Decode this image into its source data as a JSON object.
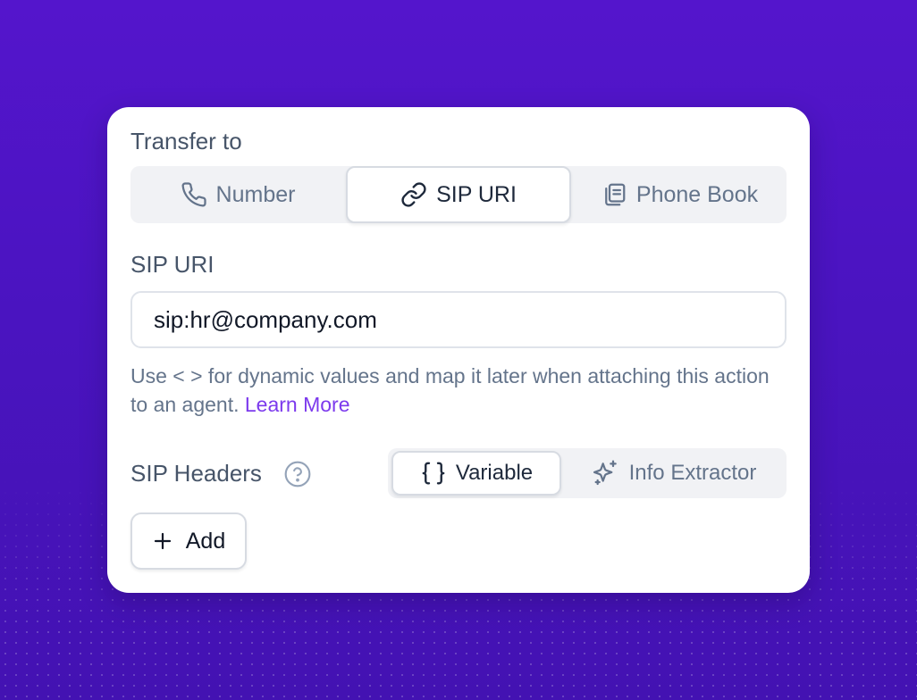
{
  "transfer": {
    "label": "Transfer to",
    "options": [
      {
        "label": "Number",
        "icon": "phone-icon",
        "selected": false
      },
      {
        "label": "SIP URI",
        "icon": "link-icon",
        "selected": true
      },
      {
        "label": "Phone Book",
        "icon": "book-icon",
        "selected": false
      }
    ]
  },
  "sip_uri": {
    "label": "SIP URI",
    "value": "sip:hr@company.com",
    "help_text": "Use < > for dynamic values and map it later when attaching this action to an agent.",
    "learn_more": "Learn More"
  },
  "sip_headers": {
    "label": "SIP Headers",
    "help_icon": "question-circle-icon",
    "options": [
      {
        "label": "Variable",
        "icon": "braces-icon",
        "selected": true
      },
      {
        "label": "Info Extractor",
        "icon": "sparkles-icon",
        "selected": false
      }
    ],
    "add_label": "Add",
    "add_icon": "plus-icon"
  },
  "colors": {
    "accent": "#7c3aed",
    "background": "#4a14c0",
    "card": "#ffffff",
    "muted_text": "#64748b"
  }
}
